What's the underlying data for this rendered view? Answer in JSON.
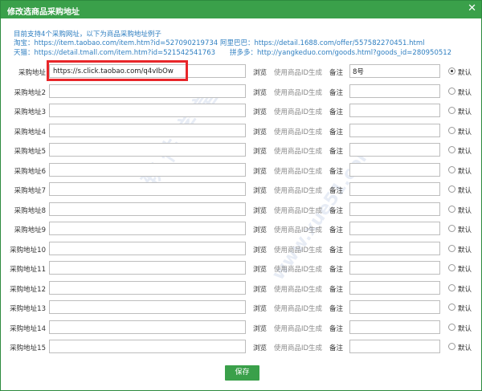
{
  "window": {
    "title": "修改选商品采购地址",
    "close": "✕"
  },
  "hints": {
    "intro": "目前支持4个采购网址，以下为商品采购地址例子",
    "taobao": "淘宝：https://item.taobao.com/item.htm?id=527090219734",
    "tmall": "天猫：https://detail.tmall.com/item.htm?id=521542541763",
    "alibaba": "阿里巴巴：https://detail.1688.com/offer/557582270451.html",
    "pdd": "拼多多：http://yangkeduo.com/goods.html?goods_id=280950512"
  },
  "rows": [
    {
      "label": "采购地址",
      "url": "https://s.click.taobao.com/q4vIbOw",
      "note": "8号",
      "selected": true
    },
    {
      "label": "采购地址2",
      "url": "",
      "note": "",
      "selected": false
    },
    {
      "label": "采购地址3",
      "url": "",
      "note": "",
      "selected": false
    },
    {
      "label": "采购地址4",
      "url": "",
      "note": "",
      "selected": false
    },
    {
      "label": "采购地址5",
      "url": "",
      "note": "",
      "selected": false
    },
    {
      "label": "采购地址6",
      "url": "",
      "note": "",
      "selected": false
    },
    {
      "label": "采购地址7",
      "url": "",
      "note": "",
      "selected": false
    },
    {
      "label": "采购地址8",
      "url": "",
      "note": "",
      "selected": false
    },
    {
      "label": "采购地址9",
      "url": "",
      "note": "",
      "selected": false
    },
    {
      "label": "采购地址10",
      "url": "",
      "note": "",
      "selected": false
    },
    {
      "label": "采购地址11",
      "url": "",
      "note": "",
      "selected": false
    },
    {
      "label": "采购地址12",
      "url": "",
      "note": "",
      "selected": false
    },
    {
      "label": "采购地址13",
      "url": "",
      "note": "",
      "selected": false
    },
    {
      "label": "采购地址14",
      "url": "",
      "note": "",
      "selected": false
    },
    {
      "label": "采购地址15",
      "url": "",
      "note": "",
      "selected": false
    }
  ],
  "row_labels": {
    "browse": "浏览",
    "generate": "使用商品ID生成",
    "note": "备注",
    "default": "默认"
  },
  "footer": {
    "save_label": "保存"
  },
  "watermark": {
    "line1": "软 件 学 堂",
    "line2": "www.xue51.com"
  },
  "colors": {
    "title_bar": "#3aa04a",
    "link_blue": "#2f7fc1",
    "highlight_red": "#e8262a"
  }
}
